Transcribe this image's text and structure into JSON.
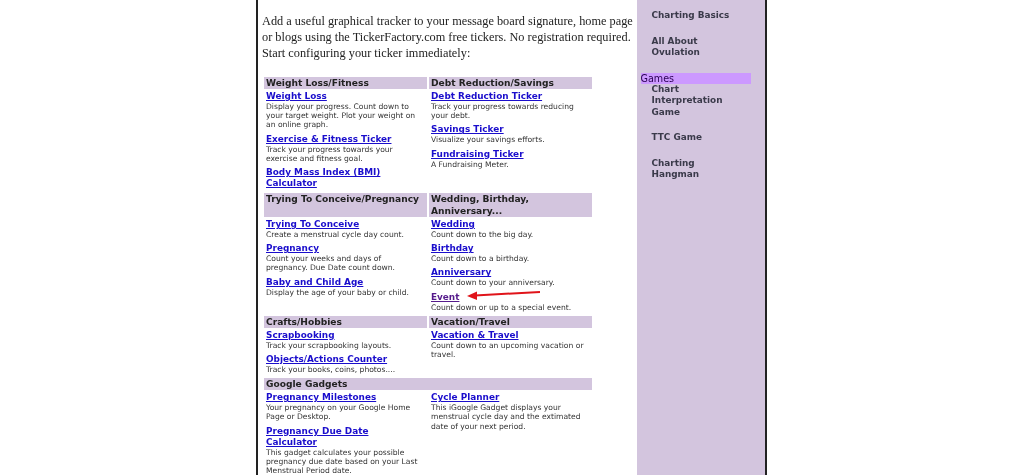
{
  "intro": "Add a useful graphical tracker to your message board signature, home page or blogs using the TickerFactory.com free tickers. No registration required. Start configuring your ticker immediately:",
  "groups": [
    {
      "headings": [
        "Weight Loss/Fitness",
        "Debt Reduction/Savings"
      ],
      "columns": [
        [
          {
            "title": "Weight Loss",
            "description": "Display your progress. Count down to your target weight. Plot your weight on an online graph.",
            "visited": false,
            "annotated": false
          },
          {
            "title": "Exercise & Fitness Ticker",
            "description": "Track your progress towards your exercise and fitness goal.",
            "visited": false,
            "annotated": false
          },
          {
            "title": "Body Mass Index (BMI) Calculator",
            "visited": false,
            "annotated": false
          }
        ],
        [
          {
            "title": "Debt Reduction Ticker",
            "description": "Track your progress towards reducing your debt.",
            "visited": false,
            "annotated": false
          },
          {
            "title": "Savings Ticker",
            "description": "Visualize your savings efforts.",
            "visited": false,
            "annotated": false
          },
          {
            "title": "Fundraising Ticker",
            "description": "A Fundraising Meter.",
            "visited": false,
            "annotated": false
          }
        ]
      ]
    },
    {
      "headings": [
        "Trying To Conceive/Pregnancy",
        "Wedding, Birthday, Anniversary..."
      ],
      "columns": [
        [
          {
            "title": "Trying To Conceive",
            "description": "Create a menstrual cycle day count.",
            "visited": false,
            "annotated": false
          },
          {
            "title": "Pregnancy",
            "description": "Count your weeks and days of pregnancy. Due Date count down.",
            "visited": false,
            "annotated": false
          },
          {
            "title": "Baby and Child Age",
            "description": "Display the age of your baby or child.",
            "visited": false,
            "annotated": false
          }
        ],
        [
          {
            "title": "Wedding",
            "description": "Count down to the big day.",
            "visited": false,
            "annotated": false
          },
          {
            "title": "Birthday",
            "description": "Count down to a birthday.",
            "visited": false,
            "annotated": false
          },
          {
            "title": "Anniversary",
            "description": "Count down to your anniversary.",
            "visited": false,
            "annotated": false
          },
          {
            "title": "Event",
            "description": "Count down or up to a special event.",
            "visited": true,
            "annotated": true
          }
        ]
      ]
    },
    {
      "headings": [
        "Crafts/Hobbies",
        "Vacation/Travel"
      ],
      "columns": [
        [
          {
            "title": "Scrapbooking",
            "description": "Track your scrapbooking layouts.",
            "visited": false,
            "annotated": false
          },
          {
            "title": "Objects/Actions Counter",
            "description": "Track your books, coins, photos....",
            "visited": false,
            "annotated": false
          }
        ],
        [
          {
            "title": "Vacation & Travel",
            "description": "Count down to an upcoming vacation or travel.",
            "visited": false,
            "annotated": false
          }
        ]
      ]
    },
    {
      "headings": [
        "Google Gadgets"
      ],
      "columns": [
        [
          {
            "title": "Pregnancy Milestones",
            "description": "Your pregnancy on your Google Home Page or Desktop.",
            "visited": false,
            "annotated": false
          },
          {
            "title": "Pregnancy Due Date Calculator",
            "description": "This gadget calculates your possible pregnancy due date based on your Last Menstrual Period date.",
            "visited": false,
            "annotated": false
          }
        ],
        [
          {
            "title": "Cycle Planner",
            "description": "This iGoogle Gadget displays your menstrual cycle day and the extimated date of your next period.",
            "visited": false,
            "annotated": false
          }
        ]
      ]
    }
  ],
  "sidebar": {
    "items": [
      {
        "kind": "link",
        "label": "Charting Basics"
      },
      {
        "kind": "link",
        "label": "All About Ovulation"
      },
      {
        "kind": "heading",
        "label": "Games",
        "children": [
          {
            "kind": "link",
            "label": "Chart Interpretation Game"
          },
          {
            "kind": "link",
            "label": "TTC Game"
          },
          {
            "kind": "link",
            "label": "Charting Hangman"
          }
        ]
      }
    ]
  }
}
